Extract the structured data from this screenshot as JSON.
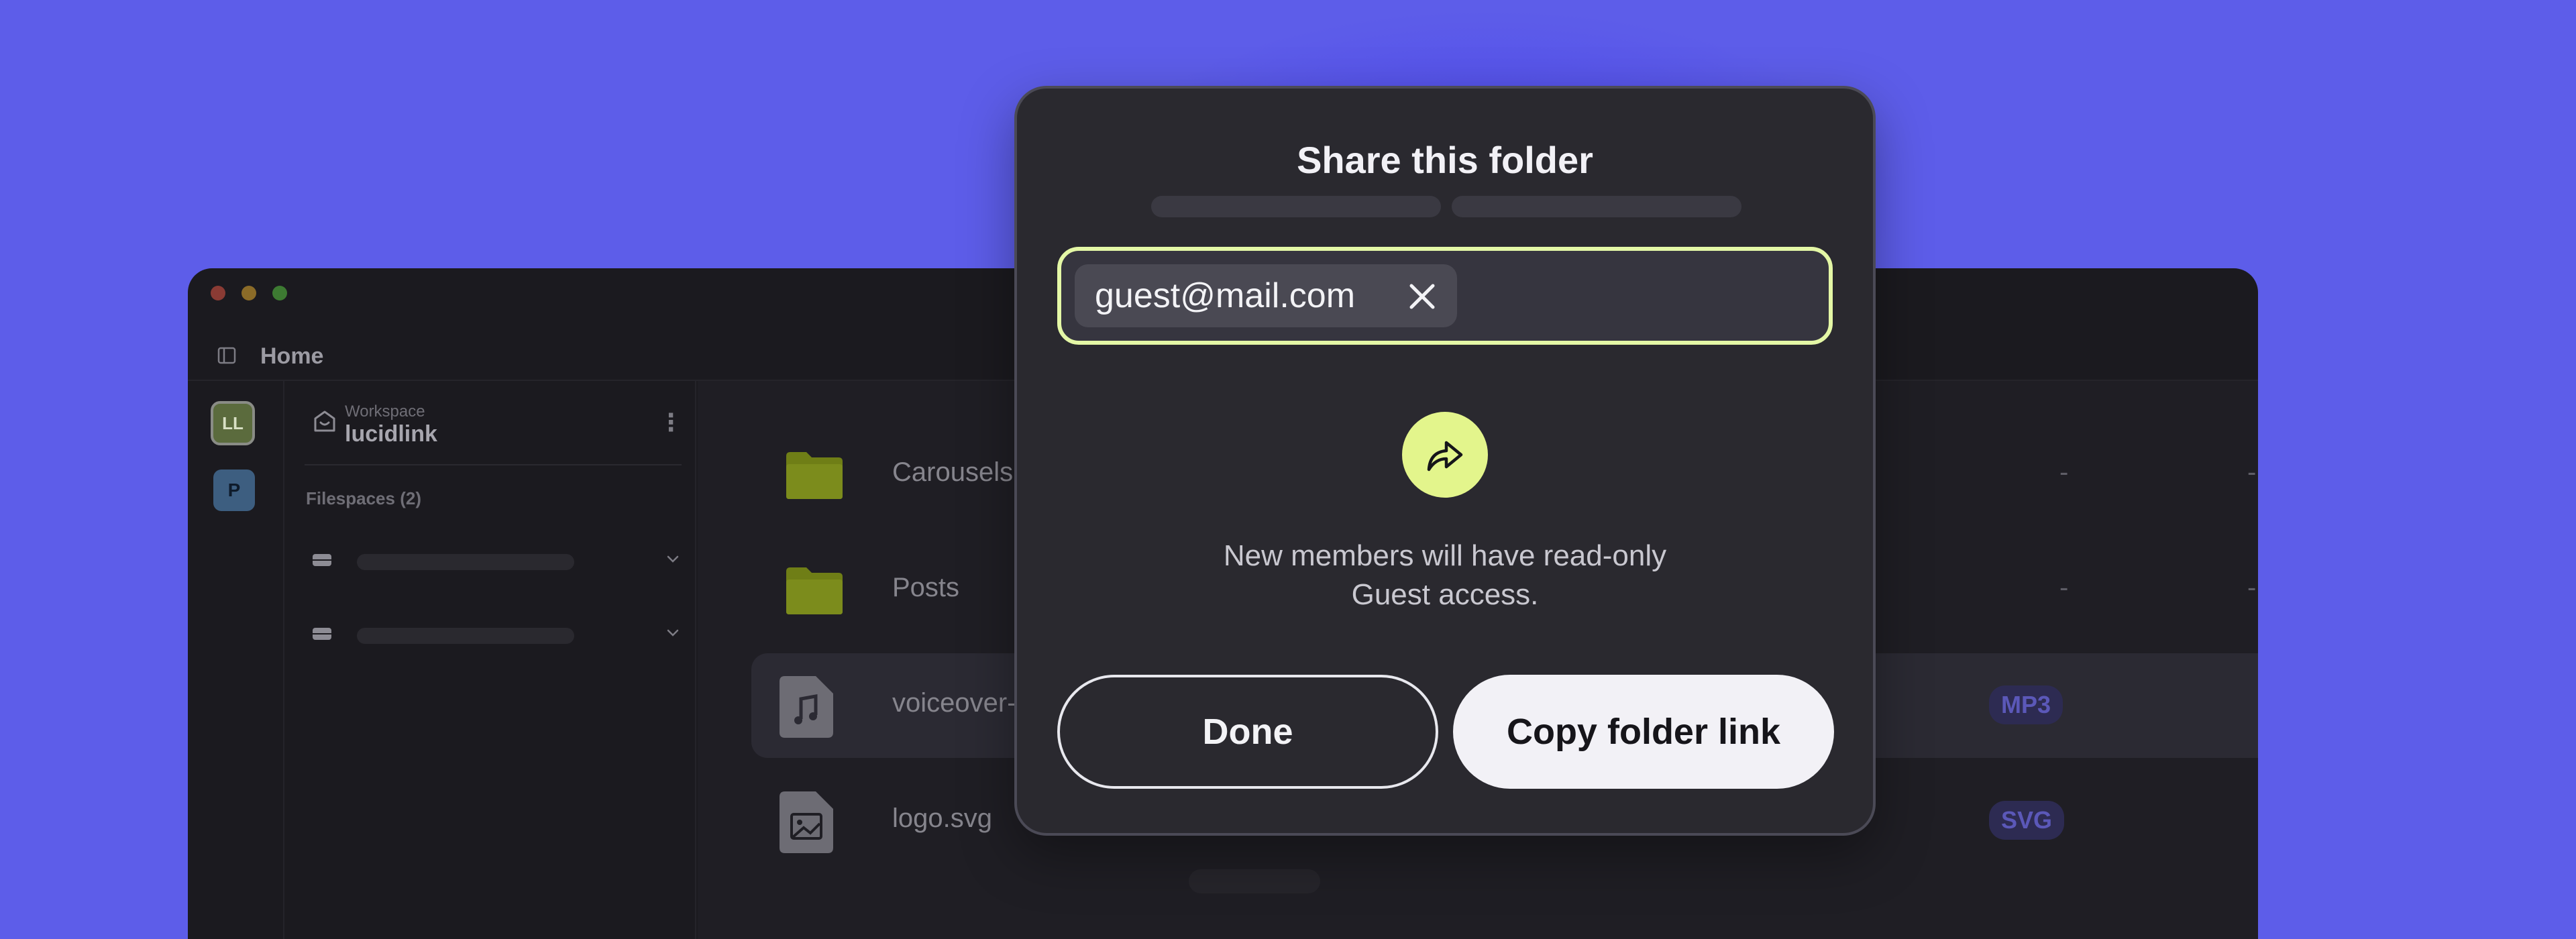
{
  "colors": {
    "background": "#5d5de9",
    "modal": "#2a292f",
    "accent_lime": "#e3f58c",
    "folder_green": "#7c8c1c",
    "badge_bg": "#2d2b52"
  },
  "app": {
    "title": "Home",
    "avatars": [
      {
        "initials": "LL"
      },
      {
        "initials": "P"
      }
    ],
    "workspace": {
      "label": "Workspace",
      "name": "lucidlink"
    },
    "filespaces_label": "Filespaces (2)",
    "files": [
      {
        "name": "Carousels",
        "icon": "folder-icon",
        "col1": "-",
        "col2": "-"
      },
      {
        "name": "Posts",
        "icon": "folder-icon",
        "col1": "-",
        "col2": "-"
      },
      {
        "name": "voiceover-",
        "icon": "music-file-icon",
        "badge": "MP3"
      },
      {
        "name": "logo.svg",
        "icon": "image-file-icon",
        "badge": "SVG"
      }
    ]
  },
  "modal": {
    "title": "Share this folder",
    "email_chip": "guest@mail.com",
    "info_line1": "New members will have read-only",
    "info_line2": "Guest access.",
    "done_label": "Done",
    "copy_label": "Copy folder link"
  }
}
